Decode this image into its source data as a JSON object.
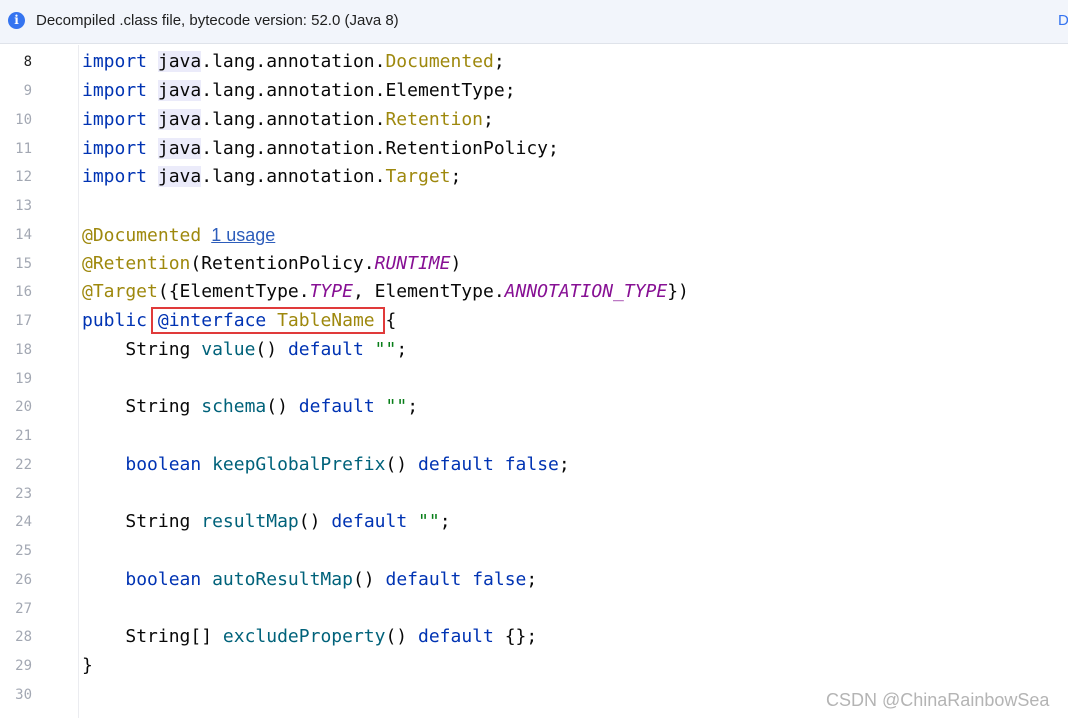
{
  "banner": {
    "info_icon": "info-icon",
    "message": "Decompiled .class file, bytecode version: 52.0 (Java 8)",
    "action": "D"
  },
  "gutter": {
    "line_numbers": [
      "8",
      "9",
      "10",
      "11",
      "12",
      "13",
      "14",
      "15",
      "16",
      "17",
      "18",
      "19",
      "20",
      "21",
      "22",
      "23",
      "24",
      "25",
      "26",
      "27",
      "28",
      "29",
      "30"
    ],
    "current_line": "8"
  },
  "code": {
    "kw_import": "import",
    "kw_public": "public",
    "kw_interface": "@interface",
    "kw_default": "default",
    "kw_boolean": "boolean",
    "kw_false": "false",
    "java": "java",
    "pkg": ".lang.annotation.",
    "semi": ";",
    "imports": [
      "Documented",
      "ElementType",
      "Retention",
      "RetentionPolicy",
      "Target"
    ],
    "ann_documented": "@Documented",
    "usage": "1 usage",
    "ann_retention": "@Retention",
    "retention_args_pre": "(RetentionPolicy.",
    "runtime": "RUNTIME",
    "paren_close": ")",
    "ann_target": "@Target",
    "target_args_pre": "({ElementType.",
    "type": "TYPE",
    "target_args_mid": ", ElementType.",
    "annotation_type": "ANNOTATION_TYPE",
    "target_args_post": "})",
    "class_name": "TableName",
    "open_brace": "{",
    "close_brace": "}",
    "string_type": "String",
    "string_array_type": "String[]",
    "empty_string": "\"\"",
    "empty_braces": "{}",
    "parens": "()",
    "methods": {
      "value": "value",
      "schema": "schema",
      "keepGlobalPrefix": "keepGlobalPrefix",
      "resultMap": "resultMap",
      "autoResultMap": "autoResultMap",
      "excludeProperty": "excludeProperty"
    }
  },
  "watermark": "CSDN @ChinaRainbowSea"
}
